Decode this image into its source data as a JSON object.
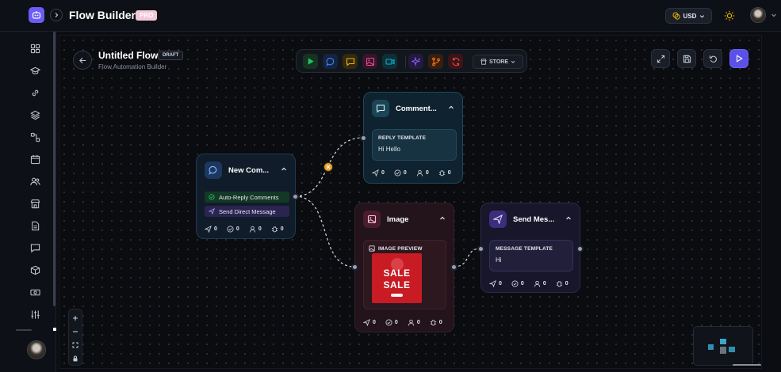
{
  "app": {
    "title": "Flow Builder",
    "badge": "PRO"
  },
  "header": {
    "currency": "USD"
  },
  "flow": {
    "title": "Untitled Flow",
    "status": "DRAFT",
    "subtitle": "Flow Automation Builder"
  },
  "toolbar": {
    "tools": [
      {
        "icon": "play-icon",
        "color": "#22c55e"
      },
      {
        "icon": "chat-bubble-icon",
        "color": "#3b82f6"
      },
      {
        "icon": "message-square-icon",
        "color": "#eab308"
      },
      {
        "icon": "image-icon",
        "color": "#ec4899"
      },
      {
        "icon": "video-icon",
        "color": "#06b6d4"
      },
      {
        "icon": "sparkles-icon",
        "color": "#8b5cf6"
      },
      {
        "icon": "git-branch-icon",
        "color": "#f97316"
      },
      {
        "icon": "refresh-icon",
        "color": "#ef4444"
      }
    ],
    "store_label": "STORE"
  },
  "nodes": {
    "comment": {
      "title": "New Com...",
      "options": [
        "Auto-Reply Comments",
        "Send Direct Message"
      ],
      "stats": [
        "0",
        "0",
        "0",
        "0"
      ]
    },
    "reply": {
      "title": "Comment...",
      "panel_label": "REPLY TEMPLATE",
      "panel_value": "Hi Hello",
      "stats": [
        "0",
        "0",
        "0",
        "0"
      ]
    },
    "image": {
      "title": "Image",
      "panel_label": "IMAGE PREVIEW",
      "preview_text": [
        "SALE",
        "SALE"
      ],
      "stats": [
        "0",
        "0",
        "0",
        "0"
      ]
    },
    "send": {
      "title": "Send Mes...",
      "panel_label": "MESSAGE TEMPLATE",
      "panel_value": "Hi",
      "stats": [
        "0",
        "0",
        "0",
        "0"
      ]
    }
  },
  "sidebar": {
    "items": [
      "dashboard-icon",
      "graduation-cap-icon",
      "link-icon",
      "layers-icon",
      "flow-icon",
      "calendar-icon",
      "users-icon",
      "store-icon",
      "document-icon",
      "chat-icon",
      "box-icon",
      "cash-icon",
      "sliders-icon"
    ]
  },
  "colors": {
    "accent": "#5b50e8",
    "canvas": "#0a0c10"
  }
}
